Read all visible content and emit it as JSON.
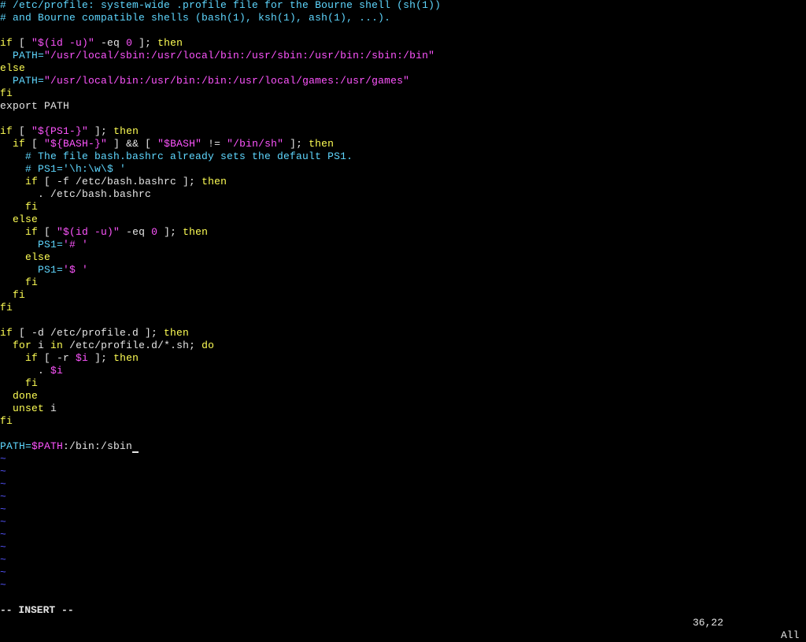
{
  "editor": {
    "lines": [
      [
        [
          "# /etc/profile: system-wide .profile file for the Bourne shell (sh(1))",
          "comment"
        ]
      ],
      [
        [
          "# and Bourne compatible shells (bash(1), ksh(1), ash(1), ...).",
          "comment"
        ]
      ],
      [],
      [
        [
          "if",
          "keyword"
        ],
        [
          " [ ",
          "plain"
        ],
        [
          "\"$(id -u)\"",
          "string"
        ],
        [
          " -eq ",
          "plain"
        ],
        [
          "0",
          "string"
        ],
        [
          " ]; ",
          "plain"
        ],
        [
          "then",
          "keyword"
        ]
      ],
      [
        [
          "  PATH=",
          "ident"
        ],
        [
          "\"/usr/local/sbin:/usr/local/bin:/usr/sbin:/usr/bin:/sbin:/bin\"",
          "string"
        ]
      ],
      [
        [
          "else",
          "keyword"
        ]
      ],
      [
        [
          "  PATH=",
          "ident"
        ],
        [
          "\"/usr/local/bin:/usr/bin:/bin:/usr/local/games:/usr/games\"",
          "string"
        ]
      ],
      [
        [
          "fi",
          "keyword"
        ]
      ],
      [
        [
          "export PATH",
          "plain"
        ]
      ],
      [],
      [
        [
          "if",
          "keyword"
        ],
        [
          " [ ",
          "plain"
        ],
        [
          "\"${PS1-}\"",
          "string"
        ],
        [
          " ]; ",
          "plain"
        ],
        [
          "then",
          "keyword"
        ]
      ],
      [
        [
          "  ",
          "plain"
        ],
        [
          "if",
          "keyword"
        ],
        [
          " [ ",
          "plain"
        ],
        [
          "\"${BASH-}\"",
          "string"
        ],
        [
          " ] && [ ",
          "plain"
        ],
        [
          "\"$BASH\"",
          "string"
        ],
        [
          " != ",
          "plain"
        ],
        [
          "\"/bin/sh\"",
          "string"
        ],
        [
          " ]; ",
          "plain"
        ],
        [
          "then",
          "keyword"
        ]
      ],
      [
        [
          "    # The file bash.bashrc already sets the default PS1.",
          "comment"
        ]
      ],
      [
        [
          "    # PS1='\\h:\\w\\$ '",
          "comment"
        ]
      ],
      [
        [
          "    ",
          "plain"
        ],
        [
          "if",
          "keyword"
        ],
        [
          " [ -f /etc/bash.bashrc ]; ",
          "plain"
        ],
        [
          "then",
          "keyword"
        ]
      ],
      [
        [
          "      . /etc/bash.bashrc",
          "plain"
        ]
      ],
      [
        [
          "    ",
          "plain"
        ],
        [
          "fi",
          "keyword"
        ]
      ],
      [
        [
          "  ",
          "plain"
        ],
        [
          "else",
          "keyword"
        ]
      ],
      [
        [
          "    ",
          "plain"
        ],
        [
          "if",
          "keyword"
        ],
        [
          " [ ",
          "plain"
        ],
        [
          "\"$(id -u)\"",
          "string"
        ],
        [
          " -eq ",
          "plain"
        ],
        [
          "0",
          "string"
        ],
        [
          " ]; ",
          "plain"
        ],
        [
          "then",
          "keyword"
        ]
      ],
      [
        [
          "      PS1=",
          "ident"
        ],
        [
          "'# '",
          "string"
        ]
      ],
      [
        [
          "    ",
          "plain"
        ],
        [
          "else",
          "keyword"
        ]
      ],
      [
        [
          "      PS1=",
          "ident"
        ],
        [
          "'$ '",
          "string"
        ]
      ],
      [
        [
          "    ",
          "plain"
        ],
        [
          "fi",
          "keyword"
        ]
      ],
      [
        [
          "  ",
          "plain"
        ],
        [
          "fi",
          "keyword"
        ]
      ],
      [
        [
          "fi",
          "keyword"
        ]
      ],
      [],
      [
        [
          "if",
          "keyword"
        ],
        [
          " [ -d /etc/profile.d ]; ",
          "plain"
        ],
        [
          "then",
          "keyword"
        ]
      ],
      [
        [
          "  ",
          "plain"
        ],
        [
          "for",
          "keyword"
        ],
        [
          " i ",
          "plain"
        ],
        [
          "in",
          "keyword"
        ],
        [
          " /etc/profile.d/*.sh; ",
          "plain"
        ],
        [
          "do",
          "keyword"
        ]
      ],
      [
        [
          "    ",
          "plain"
        ],
        [
          "if",
          "keyword"
        ],
        [
          " [ -r ",
          "plain"
        ],
        [
          "$i",
          "string"
        ],
        [
          " ]; ",
          "plain"
        ],
        [
          "then",
          "keyword"
        ]
      ],
      [
        [
          "      . ",
          "plain"
        ],
        [
          "$i",
          "string"
        ]
      ],
      [
        [
          "    ",
          "plain"
        ],
        [
          "fi",
          "keyword"
        ]
      ],
      [
        [
          "  ",
          "plain"
        ],
        [
          "done",
          "keyword"
        ]
      ],
      [
        [
          "  ",
          "plain"
        ],
        [
          "unset",
          "keyword"
        ],
        [
          " i",
          "plain"
        ]
      ],
      [
        [
          "fi",
          "keyword"
        ]
      ],
      [],
      [
        [
          "PATH=",
          "ident"
        ],
        [
          "$PATH",
          "string"
        ],
        [
          ":/bin:/sbin",
          "plain"
        ]
      ]
    ],
    "cursor_line": 36,
    "cursor_col": 22,
    "tilde": "~",
    "tilde_count": 11
  },
  "status": {
    "mode": "-- INSERT --",
    "position": "36,22",
    "scroll": "All"
  },
  "colors": {
    "background": "#000000",
    "text": "#e6e6e6",
    "comment": "#5fd7ff",
    "keyword": "#ffff55",
    "string": "#ff55ff",
    "tilde": "#5555ff"
  }
}
